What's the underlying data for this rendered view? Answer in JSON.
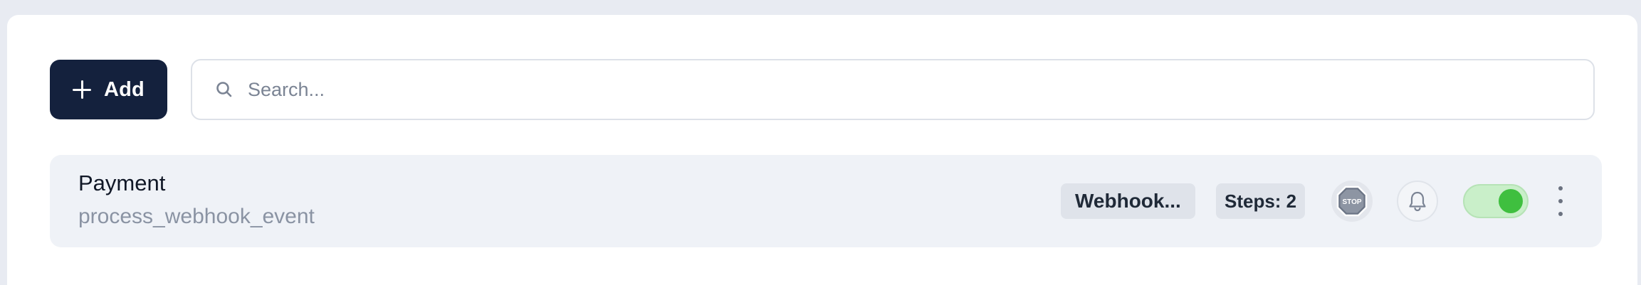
{
  "toolbar": {
    "add_label": "Add",
    "search_placeholder": "Search...",
    "search_value": ""
  },
  "items": [
    {
      "title": "Payment",
      "subtitle": "process_webhook_event",
      "type_label": "Webhook...",
      "steps_label": "Steps: 2",
      "stop_icon_text": "STOP",
      "enabled": true
    }
  ],
  "colors": {
    "page_bg": "#e8ebf2",
    "add_button_bg": "#14213d",
    "row_bg": "#eff2f7",
    "toggle_on_track": "#c9efc9",
    "toggle_on_knob": "#3fbf3f"
  },
  "icons": {
    "add": "plus-icon",
    "search": "search-icon",
    "stop": "stop-sign-icon",
    "notify": "bell-icon",
    "more": "vertical-ellipsis-icon"
  }
}
